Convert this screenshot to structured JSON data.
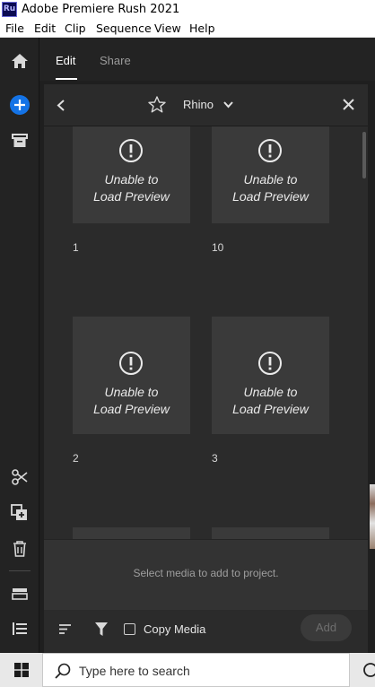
{
  "window": {
    "app_icon_text": "Ru",
    "title": "Adobe Premiere Rush 2021"
  },
  "menu": {
    "items": [
      "File",
      "Edit",
      "Clip",
      "Sequence",
      "View",
      "Help"
    ]
  },
  "left_rail": {
    "icons": [
      "home-icon",
      "add-media-icon",
      "archive-icon",
      "scissors-icon",
      "duplicate-icon",
      "trash-icon",
      "storage-icon",
      "list-icon"
    ],
    "add_button_color": "#1473e6"
  },
  "tabs": {
    "edit": "Edit",
    "share": "Share",
    "active": "Edit"
  },
  "media_panel": {
    "folder_name": "Rhino",
    "tiles": [
      {
        "label": "1",
        "line1": "Unable to",
        "line2": "Load Preview"
      },
      {
        "label": "10",
        "line1": "Unable to",
        "line2": "Load Preview"
      },
      {
        "label": "2",
        "line1": "Unable to",
        "line2": "Load Preview"
      },
      {
        "label": "3",
        "line1": "Unable to",
        "line2": "Load Preview"
      }
    ],
    "select_hint": "Select media to add to project.",
    "copy_media_label": "Copy Media",
    "copy_media_checked": false,
    "add_label": "Add"
  },
  "taskbar": {
    "search_placeholder": "Type here to search"
  }
}
